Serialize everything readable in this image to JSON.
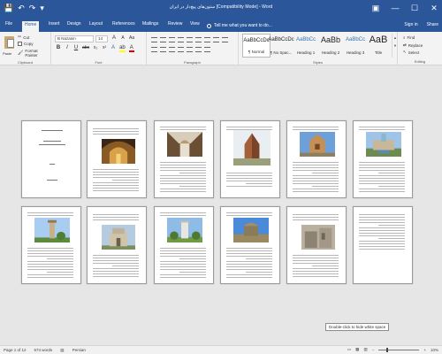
{
  "titlebar": {
    "title": "ستون‌های پیچ‌دار در ایران [Compatibility Mode] - Word",
    "qat": {
      "save": "💾",
      "undo": "↶",
      "redo": "↷",
      "customize": "▾"
    },
    "controls": {
      "ribbon_options": "▣",
      "minimize": "—",
      "maximize": "☐",
      "close": "✕"
    }
  },
  "tabs": [
    "File",
    "Home",
    "Insert",
    "Design",
    "Layout",
    "References",
    "Mailings",
    "Review",
    "View"
  ],
  "tell_me": "Tell me what you want to do...",
  "account": {
    "sign_in": "Sign in",
    "share": "Share"
  },
  "ribbon": {
    "clipboard": {
      "paste": "Paste",
      "cut": "Cut",
      "copy": "Copy",
      "format_painter": "Format Painter",
      "label": "Clipboard"
    },
    "font": {
      "name": "B Nazanin",
      "size": "14",
      "bold": "B",
      "italic": "I",
      "underline": "U",
      "strike": "abc",
      "sub": "x₂",
      "sup": "x²",
      "label": "Font"
    },
    "paragraph": {
      "label": "Paragraph"
    },
    "styles": {
      "items": [
        {
          "sample": "AaBbCcDc",
          "name": "¶ Normal"
        },
        {
          "sample": "AaBbCcDc",
          "name": "¶ No Spac..."
        },
        {
          "sample": "AaBbCc",
          "name": "Heading 1"
        },
        {
          "sample": "AaBb",
          "name": "Heading 2"
        },
        {
          "sample": "AaBbCc",
          "name": "Heading 3"
        },
        {
          "sample": "AaB",
          "name": "Title"
        }
      ],
      "label": "Styles"
    },
    "editing": {
      "find": "Find",
      "replace": "Replace",
      "select": "Select",
      "label": "Editing"
    }
  },
  "tooltip": "Double-click to hide white space",
  "status": {
    "page": "Page 1 of 12",
    "words": "574 words",
    "language": "Persian",
    "zoom": "10%",
    "zoom_fraction": 0.2
  },
  "colors": {
    "brand": "#2b579a",
    "ribbon": "#f3f3f3",
    "canvas": "#e6e6e6"
  },
  "pages": [
    {
      "kind": "title"
    },
    {
      "kind": "text-image",
      "image": "interior"
    },
    {
      "kind": "image-text",
      "image": "bazaar"
    },
    {
      "kind": "image",
      "image": "dome-brick"
    },
    {
      "kind": "image-text",
      "image": "dome-tower"
    },
    {
      "kind": "image-text",
      "image": "mosque"
    },
    {
      "kind": "image-text",
      "image": "minaret"
    },
    {
      "kind": "text-image",
      "image": "tomb"
    },
    {
      "kind": "image-text",
      "image": "tower-white"
    },
    {
      "kind": "image-text",
      "image": "ruins-sky"
    },
    {
      "kind": "text-image",
      "image": "stone-ruins"
    },
    {
      "kind": "text"
    }
  ]
}
